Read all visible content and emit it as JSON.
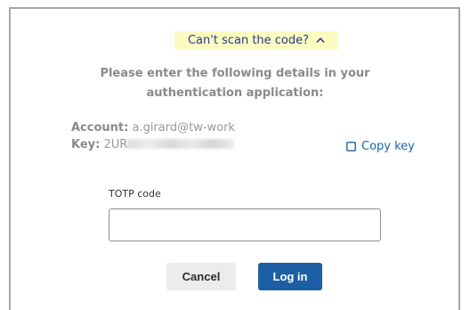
{
  "toggle": {
    "label": "Can't scan the code?",
    "icon": "chevron-up-icon"
  },
  "instructions": "Please enter the following details in your authentication application:",
  "account": {
    "label": "Account:",
    "value": "a.girard@tw-work"
  },
  "key": {
    "label": "Key:",
    "value_visible": "2UR"
  },
  "copy_key": {
    "label": "Copy key",
    "icon": "copy-icon"
  },
  "totp": {
    "label": "TOTP code",
    "value": "",
    "placeholder": ""
  },
  "buttons": {
    "cancel": "Cancel",
    "login": "Log in"
  },
  "colors": {
    "accent": "#1c5fa4",
    "highlight": "#fbfbc2",
    "link": "#1c63a8"
  }
}
